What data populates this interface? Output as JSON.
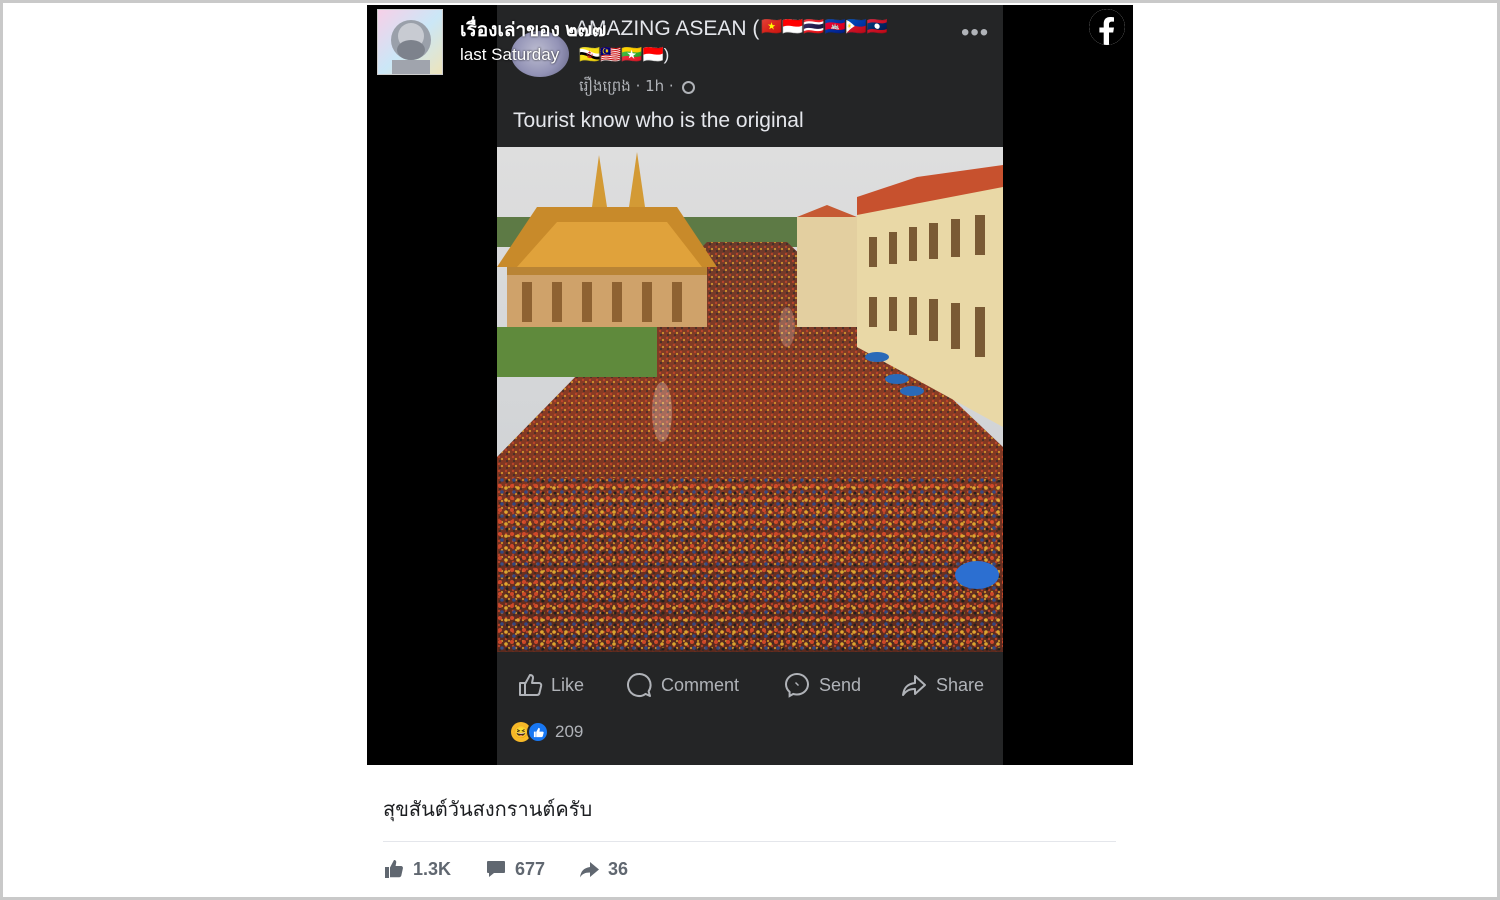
{
  "post": {
    "author_name": "เรื่องเล่าของ ๒๗๗",
    "timestamp": "last Saturday",
    "caption": "สุขสันต์วันสงกรานต์ครับ",
    "stats": {
      "likes": "1.3K",
      "comments": "677",
      "shares": "36"
    }
  },
  "embedded": {
    "page_name": "AMAZING ASEAN (",
    "flags_row1": "🇻🇳🇮🇩🇹🇭🇰🇭🇵🇭🇱🇦",
    "flags_row2": "🇧🇳🇲🇾🇲🇲🇮🇩)",
    "sub_author": "រឿងព្រេង",
    "sub_time": "· 1h ·",
    "post_text": "Tourist know who is the original",
    "actions": {
      "like": "Like",
      "comment": "Comment",
      "send": "Send",
      "share": "Share"
    },
    "reaction_count": "209",
    "more_label": "•••"
  },
  "icons": [
    "like-icon",
    "comment-icon",
    "send-icon",
    "share-icon",
    "facebook-logo-icon",
    "globe-icon"
  ],
  "colors": {
    "dark_surface": "#242526",
    "text_secondary": "#606770",
    "fb_blue": "#1877f2"
  }
}
